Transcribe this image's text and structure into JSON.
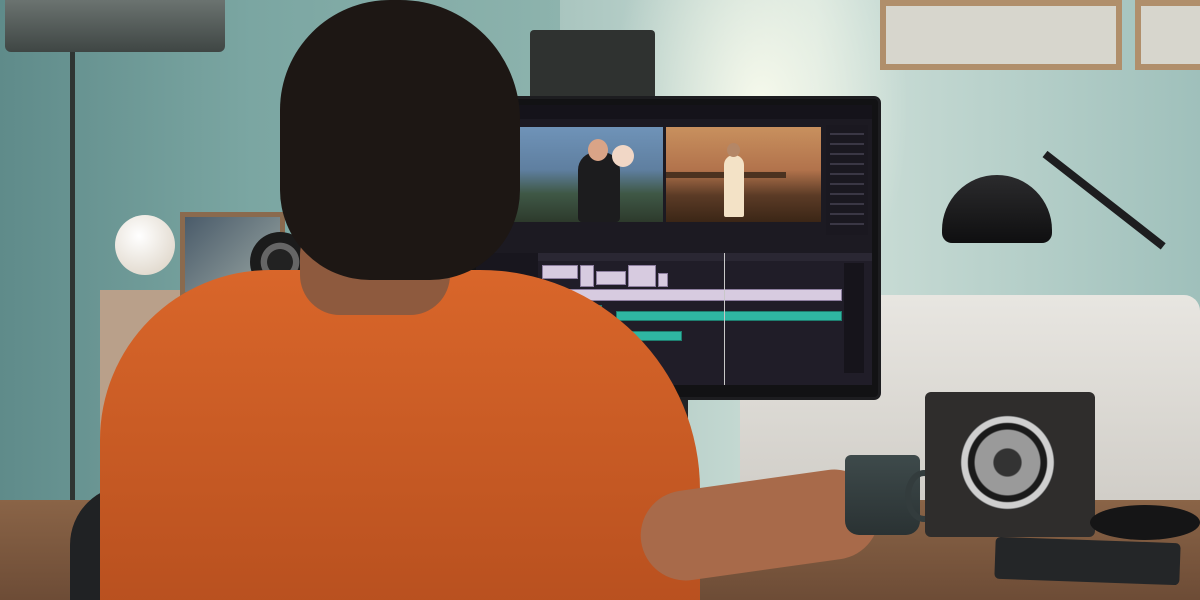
{
  "scene": {
    "description_tags": [
      "person-at-desk",
      "video-editing-monitor",
      "desk-lamp",
      "speaker",
      "mug"
    ]
  },
  "editor": {
    "viewer_titles": [
      "",
      ""
    ],
    "transport_left": "",
    "transport_right": "",
    "track_labels": [
      "",
      "",
      "",
      "",
      "",
      "",
      "",
      ""
    ]
  }
}
